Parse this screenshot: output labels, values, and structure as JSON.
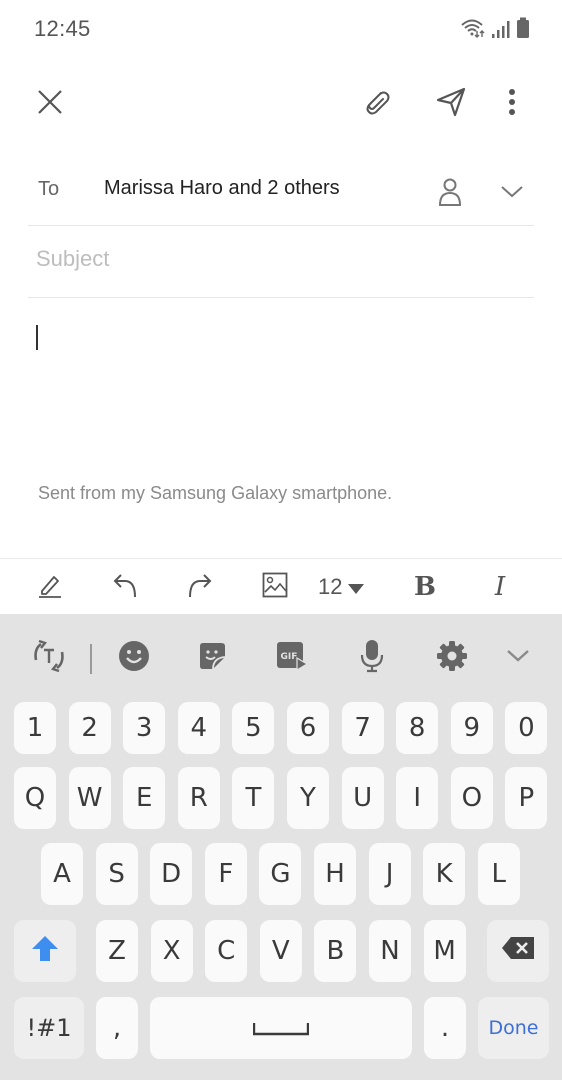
{
  "status_bar": {
    "time": "12:45",
    "icons": [
      "wifi-icon",
      "signal-icon",
      "battery-icon"
    ]
  },
  "action_bar": {
    "close": "close-icon",
    "attach": "paperclip-icon",
    "send": "send-icon",
    "more": "more-vert-icon"
  },
  "compose": {
    "to_label": "To",
    "to_value": "Marissa Haro and 2 others",
    "subject_placeholder": "Subject",
    "subject_value": "",
    "body_value": "",
    "signature": "Sent from my Samsung Galaxy smartphone."
  },
  "format_toolbar": {
    "items": [
      "pen-icon",
      "undo-icon",
      "redo-icon",
      "image-icon",
      "font-size",
      "bold-icon",
      "italic-icon"
    ],
    "font_size": "12",
    "bold_label": "B",
    "italic_label": "I"
  },
  "keyboard": {
    "toolbar": [
      "text-convert-icon",
      "emoji-icon",
      "sticker-icon",
      "gif-icon",
      "mic-icon",
      "settings-icon",
      "collapse-icon"
    ],
    "gif_label": "GIF",
    "row_numbers": [
      "1",
      "2",
      "3",
      "4",
      "5",
      "6",
      "7",
      "8",
      "9",
      "0"
    ],
    "row_top": [
      "Q",
      "W",
      "E",
      "R",
      "T",
      "Y",
      "U",
      "I",
      "O",
      "P"
    ],
    "row_middle": [
      "A",
      "S",
      "D",
      "F",
      "G",
      "H",
      "J",
      "K",
      "L"
    ],
    "row_bottom": [
      "Z",
      "X",
      "C",
      "V",
      "B",
      "N",
      "M"
    ],
    "symbols_label": "!#1",
    "comma_label": ",",
    "period_label": ".",
    "done_label": "Done",
    "shift_color": "#3e8ef0",
    "done_color": "#3e6fd6"
  }
}
